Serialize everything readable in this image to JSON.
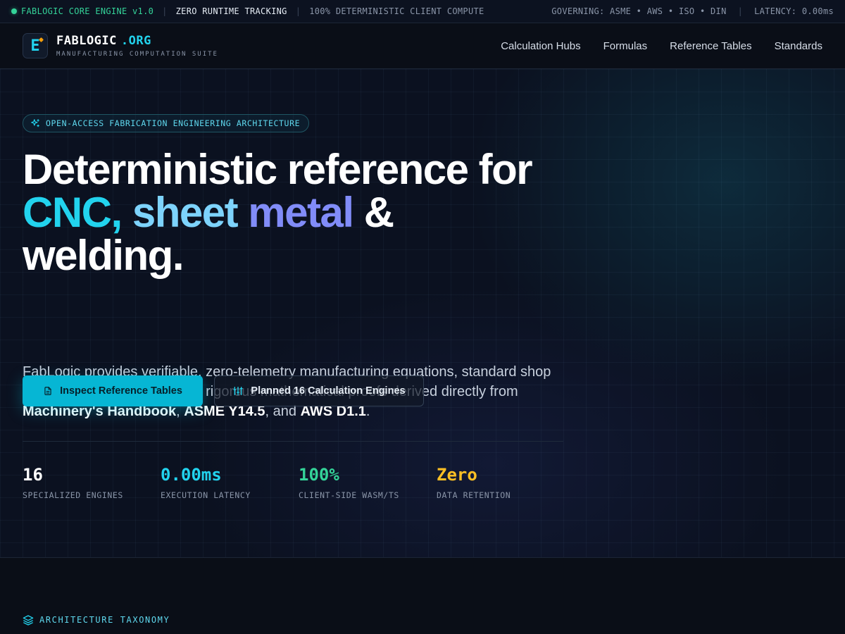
{
  "topbar": {
    "engine": "FABLOGIC CORE ENGINE v1.0",
    "tracking": "ZERO RUNTIME TRACKING",
    "compute": "100% DETERMINISTIC CLIENT COMPUTE",
    "governing": "GOVERNING: ASME • AWS • ISO • DIN",
    "latency": "LATENCY: 0.00ms"
  },
  "brand": {
    "logo_letter": "E",
    "name": "FABLOGIC",
    "tld": ".ORG",
    "subtitle": "MANUFACTURING COMPUTATION SUITE"
  },
  "nav": {
    "items": [
      {
        "label": "Calculation Hubs"
      },
      {
        "label": "Formulas"
      },
      {
        "label": "Reference Tables"
      },
      {
        "label": "Standards"
      }
    ]
  },
  "hero": {
    "badge": "OPEN-ACCESS FABRICATION ENGINEERING ARCHITECTURE",
    "headline": {
      "line1": "Deterministic reference for",
      "cnc": "CNC,",
      "sheet": "sheet",
      "metal": "metal",
      "amp": "&",
      "line3": "welding."
    },
    "lead": {
      "intro": "FabLogic provides verifiable, zero-telemetry manufacturing equations, standard shop floor reference matrices, and rigorous mathematical proofs derived directly from ",
      "ref1": "Machinery's Handbook",
      "sep1": ", ",
      "ref2": "ASME Y14.5",
      "sep2": ", and ",
      "ref3": "AWS D1.1",
      "end": "."
    },
    "primary_button": "Inspect Reference Tables",
    "secondary_button": "Planned 16 Calculation Engines",
    "stats": [
      {
        "value": "16",
        "label": "SPECIALIZED ENGINES",
        "color": "#ffffff"
      },
      {
        "value": "0.00ms",
        "label": "EXECUTION LATENCY",
        "color": "#22d3ee"
      },
      {
        "value": "100%",
        "label": "CLIENT-SIDE WASM/TS",
        "color": "#34d399"
      },
      {
        "value": "Zero",
        "label": "DATA RETENTION",
        "color": "#fbbf24"
      }
    ]
  },
  "section": {
    "label": "ARCHITECTURE TAXONOMY"
  },
  "colors": {
    "accent": "#22d3ee",
    "primary_button": "#06b6d4",
    "status_green": "#34d399",
    "indigo": "#818cf8",
    "amber": "#fbbf24"
  },
  "icons": {
    "badge": "sparkles-icon",
    "primary_button": "document-icon",
    "secondary_button": "sliders-icon",
    "section": "layers-icon"
  }
}
